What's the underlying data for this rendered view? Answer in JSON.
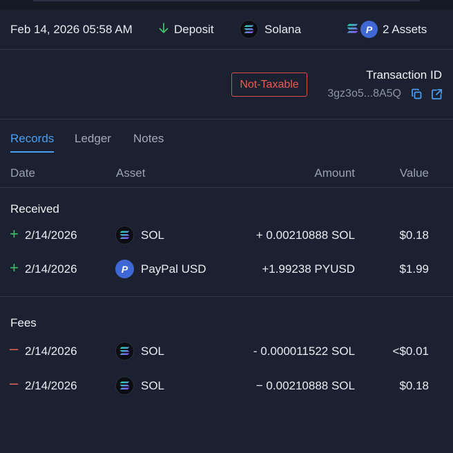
{
  "summary": {
    "datetime": "Feb 14, 2026 05:58 AM",
    "type": "Deposit",
    "chain": "Solana",
    "assets_count": "2 Assets"
  },
  "status_badge": "Not-Taxable",
  "transaction": {
    "label": "Transaction ID",
    "id": "3gz3o5...8A5Q"
  },
  "tabs": [
    "Records",
    "Ledger",
    "Notes"
  ],
  "columns": [
    "Date",
    "Asset",
    "Amount",
    "Value"
  ],
  "received": {
    "title": "Received",
    "rows": [
      {
        "sign": "+",
        "date": "2/14/2026",
        "asset": "SOL",
        "icon": "solana-icon",
        "amount": "+ 0.00210888 SOL",
        "value": "$0.18"
      },
      {
        "sign": "+",
        "date": "2/14/2026",
        "asset": "PayPal USD",
        "icon": "paypal-icon",
        "amount": "+1.99238 PYUSD",
        "value": "$1.99"
      }
    ]
  },
  "fees": {
    "title": "Fees",
    "rows": [
      {
        "sign": "–",
        "date": "2/14/2026",
        "asset": "SOL",
        "icon": "solana-icon",
        "amount": "- 0.000011522 SOL",
        "value": "<$0.01"
      },
      {
        "sign": "–",
        "date": "2/14/2026",
        "asset": "SOL",
        "icon": "solana-icon",
        "amount": "− 0.00210888 SOL",
        "value": "$0.18"
      }
    ]
  },
  "colors": {
    "background": "#1b2130",
    "accent_blue": "#4b9ef0",
    "positive_green": "#3fbf6a",
    "negative_orange": "#e8654f",
    "badge_red": "#e0504a"
  }
}
